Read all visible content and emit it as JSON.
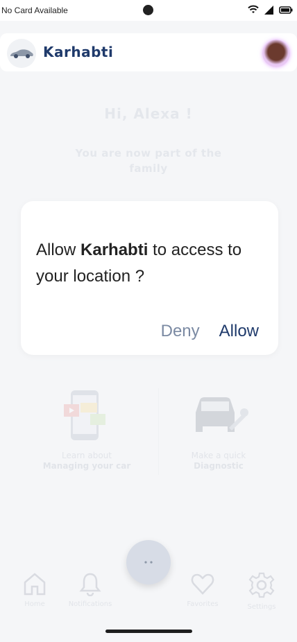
{
  "status_bar": {
    "carrier": "No Card Available",
    "icons": [
      "wifi-icon",
      "signal-icon",
      "battery-icon"
    ]
  },
  "app_bar": {
    "title": "Karhabti",
    "logo_icon": "car-icon",
    "avatar": "profile-avatar"
  },
  "home": {
    "greeting": "Hi, Alexa !",
    "subtitle": "You are now part of the family",
    "tiles": [
      {
        "line1": "Learn about",
        "line2": "Managing your car",
        "icon": "phone-video-icon"
      },
      {
        "line1": "Make a quick",
        "line2": "Diagnostic",
        "icon": "car-wrench-icon"
      }
    ]
  },
  "bottom_nav": {
    "items": [
      {
        "label": "Home",
        "icon": "home-icon"
      },
      {
        "label": "Notifications",
        "icon": "bell-icon"
      },
      {
        "label": "Favorites",
        "icon": "heart-icon"
      },
      {
        "label": "Settings",
        "icon": "gear-icon"
      }
    ]
  },
  "dialog": {
    "prefix": "Allow ",
    "app_name": "Karhabti",
    "suffix": " to access to your location ?",
    "deny_label": "Deny",
    "allow_label": "Allow"
  },
  "colors": {
    "brand": "#1f3a6b",
    "deny": "#7b8aa3",
    "background": "#f5f6f8"
  }
}
